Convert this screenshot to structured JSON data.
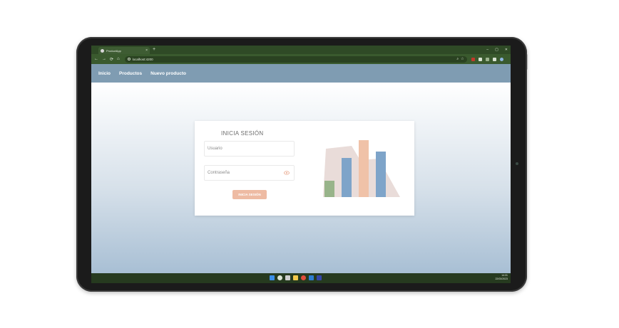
{
  "browser": {
    "tab_title": "ProductApp",
    "tab_close": "×",
    "new_tab": "+",
    "url": "localhost:4200",
    "nav": {
      "back": "←",
      "forward": "→",
      "reload": "⟳",
      "home": "⌂"
    },
    "window_controls": {
      "minimize": "–",
      "maximize": "▢",
      "close": "✕"
    }
  },
  "app": {
    "nav": {
      "home": "Inicio",
      "products": "Productos",
      "new_product": "Nuevo producto"
    },
    "login": {
      "title": "INICIA SESIÓN",
      "username_placeholder": "Usuario",
      "password_placeholder": "Contraseña",
      "submit_label": "INICIA SESIÓN"
    }
  },
  "illustration": {
    "icon": "bar-chart-illustration",
    "colors": {
      "backdrop": "#e9dcd9",
      "green": "#98b48a",
      "blue": "#7ea4c9",
      "peach": "#f0c2a8"
    }
  },
  "taskbar": {
    "clock_time": "14:31",
    "clock_date": "22/03/2023"
  },
  "colors": {
    "app_nav": "#7f9cb2",
    "browser_chrome": "#3a5a2e",
    "accent_button": "#eebba3"
  }
}
